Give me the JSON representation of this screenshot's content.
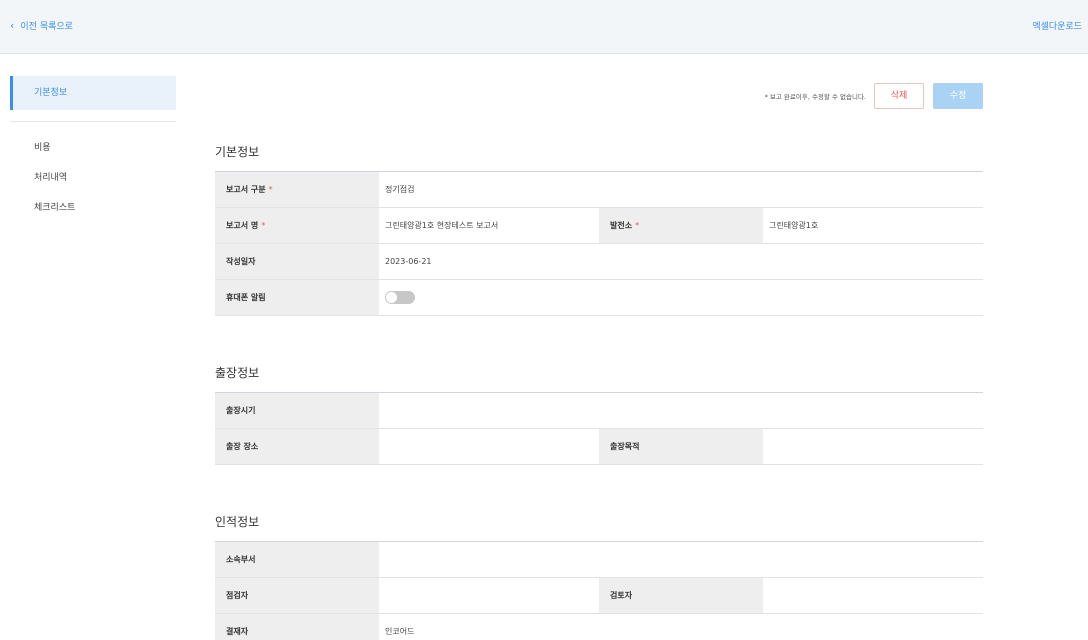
{
  "header": {
    "back_label": "이전 목록으로",
    "excel_label": "엑셀다운로드"
  },
  "sidebar": {
    "items": [
      {
        "label": "기본정보",
        "active": true
      },
      {
        "label": "비용",
        "active": false
      },
      {
        "label": "처리내역",
        "active": false
      },
      {
        "label": "체크리스트",
        "active": false
      }
    ]
  },
  "actions": {
    "notice": "* 보고 완료이후, 수정할 수 없습니다.",
    "delete_label": "삭제",
    "edit_label": "수정"
  },
  "basic_info": {
    "title": "기본정보",
    "report_type_label": "보고서 구분",
    "report_type_value": "정기점검",
    "report_name_label": "보고서 명",
    "report_name_value": "그린태양광1호 현장테스트 보고서",
    "plant_label": "발전소",
    "plant_value": "그린태양광1호",
    "date_label": "작성일자",
    "date_value": "2023-06-21",
    "phone_alert_label": "휴대폰 알림",
    "phone_alert_on": false,
    "required_mark": "*"
  },
  "trip_info": {
    "title": "출장정보",
    "time_label": "출장시기",
    "time_value": "",
    "place_label": "출장 장소",
    "place_value": "",
    "purpose_label": "출장목적",
    "purpose_value": ""
  },
  "personnel_info": {
    "title": "인적정보",
    "dept_label": "소속부서",
    "dept_value": "",
    "inspector_label": "점검자",
    "inspector_value": "",
    "reviewer_label": "검토자",
    "reviewer_value": "",
    "approver_label": "결재자",
    "approver_value": "인코어드"
  }
}
